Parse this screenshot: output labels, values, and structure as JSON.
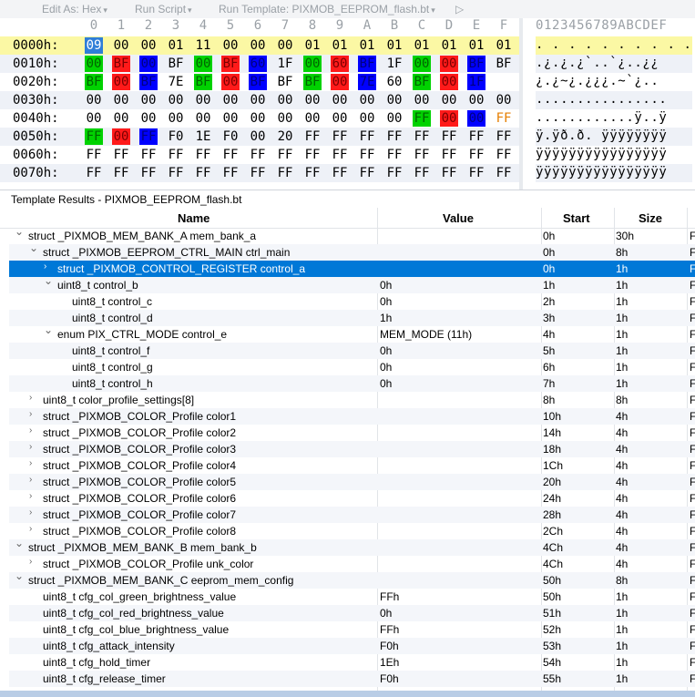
{
  "toolbar": {
    "edit_as": "Edit As: Hex",
    "run_script": "Run Script",
    "run_template": "Run Template: PIXMOB_EEPROM_flash.bt"
  },
  "hex": {
    "column_headers": [
      "0",
      "1",
      "2",
      "3",
      "4",
      "5",
      "6",
      "7",
      "8",
      "9",
      "A",
      "B",
      "C",
      "D",
      "E",
      "F"
    ],
    "ascii_header": "0123456789ABCDEF",
    "rows": [
      {
        "addr": "0000h:",
        "bytes": [
          "09",
          "00",
          "00",
          "01",
          "11",
          "00",
          "00",
          "00",
          "01",
          "01",
          "01",
          "01",
          "01",
          "01",
          "01",
          "01"
        ],
        "ascii": ".  . . . . . . . . . . . . . ."
      },
      {
        "addr": "0010h:",
        "bytes": [
          "00",
          "BF",
          "00",
          "BF",
          "00",
          "BF",
          "60",
          "1F",
          "00",
          "60",
          "BF",
          "1F",
          "00",
          "00",
          "BF",
          "BF"
        ],
        "ascii": ".¿.¿.¿`..`¿..¿¿"
      },
      {
        "addr": "0020h:",
        "bytes": [
          "BF",
          "00",
          "BF",
          "7E",
          "BF",
          "00",
          "BF",
          "BF",
          "BF",
          "00",
          "7E",
          "60",
          "BF",
          "00",
          "1F",
          ""
        ],
        "ascii": "¿.¿~¿.¿¿¿.~`¿.."
      },
      {
        "addr": "0030h:",
        "bytes": [
          "00",
          "00",
          "00",
          "00",
          "00",
          "00",
          "00",
          "00",
          "00",
          "00",
          "00",
          "00",
          "00",
          "00",
          "00",
          "00"
        ],
        "ascii": "................"
      },
      {
        "addr": "0040h:",
        "bytes": [
          "00",
          "00",
          "00",
          "00",
          "00",
          "00",
          "00",
          "00",
          "00",
          "00",
          "00",
          "00",
          "FF",
          "00",
          "00",
          "FF"
        ],
        "ascii": "............ÿ..ÿ"
      },
      {
        "addr": "0050h:",
        "bytes": [
          "FF",
          "00",
          "FF",
          "F0",
          "1E",
          "F0",
          "00",
          "20",
          "FF",
          "FF",
          "FF",
          "FF",
          "FF",
          "FF",
          "FF",
          "FF"
        ],
        "ascii": "ÿ.ÿð.ð. ÿÿÿÿÿÿÿÿ"
      },
      {
        "addr": "0060h:",
        "bytes": [
          "FF",
          "FF",
          "FF",
          "FF",
          "FF",
          "FF",
          "FF",
          "FF",
          "FF",
          "FF",
          "FF",
          "FF",
          "FF",
          "FF",
          "FF",
          "FF"
        ],
        "ascii": "ÿÿÿÿÿÿÿÿÿÿÿÿÿÿÿÿ"
      },
      {
        "addr": "0070h:",
        "bytes": [
          "FF",
          "FF",
          "FF",
          "FF",
          "FF",
          "FF",
          "FF",
          "FF",
          "FF",
          "FF",
          "FF",
          "FF",
          "FF",
          "FF",
          "FF",
          "FF"
        ],
        "ascii": "ÿÿÿÿÿÿÿÿÿÿÿÿÿÿÿÿ"
      }
    ]
  },
  "template_results": {
    "title": "Template Results - PIXMOB_EEPROM_flash.bt",
    "columns": {
      "name": "Name",
      "value": "Value",
      "start": "Start",
      "size": "Size"
    },
    "rows": [
      {
        "indent": 0,
        "twisty": "open",
        "name": "struct _PIXMOB_MEM_BANK_A mem_bank_a",
        "value": "",
        "start": "0h",
        "size": "30h",
        "color": "F"
      },
      {
        "indent": 1,
        "twisty": "open",
        "name": "struct _PIXMOB_EEPROM_CTRL_MAIN ctrl_main",
        "value": "",
        "start": "0h",
        "size": "8h",
        "color": "F"
      },
      {
        "indent": 2,
        "twisty": "closed",
        "name": "struct _PIXMOB_CONTROL_REGISTER control_a",
        "value": "",
        "start": "0h",
        "size": "1h",
        "color": "F",
        "selected": true
      },
      {
        "indent": 2,
        "twisty": "open",
        "name": "uint8_t control_b",
        "value": "0h",
        "start": "1h",
        "size": "1h",
        "color": "F"
      },
      {
        "indent": 3,
        "twisty": "",
        "name": "uint8_t control_c",
        "value": "0h",
        "start": "2h",
        "size": "1h",
        "color": "F"
      },
      {
        "indent": 3,
        "twisty": "",
        "name": "uint8_t control_d",
        "value": "1h",
        "start": "3h",
        "size": "1h",
        "color": "F"
      },
      {
        "indent": 2,
        "twisty": "open",
        "name": "enum PIX_CTRL_MODE control_e",
        "value": "MEM_MODE (11h)",
        "start": "4h",
        "size": "1h",
        "color": "F"
      },
      {
        "indent": 3,
        "twisty": "",
        "name": "uint8_t control_f",
        "value": "0h",
        "start": "5h",
        "size": "1h",
        "color": "F"
      },
      {
        "indent": 3,
        "twisty": "",
        "name": "uint8_t control_g",
        "value": "0h",
        "start": "6h",
        "size": "1h",
        "color": "F"
      },
      {
        "indent": 3,
        "twisty": "",
        "name": "uint8_t control_h",
        "value": "0h",
        "start": "7h",
        "size": "1h",
        "color": "F"
      },
      {
        "indent": 1,
        "twisty": "closed",
        "name": "uint8_t color_profile_settings[8]",
        "value": "",
        "start": "8h",
        "size": "8h",
        "color": "F"
      },
      {
        "indent": 1,
        "twisty": "closed",
        "name": "struct _PIXMOB_COLOR_Profile color1",
        "value": "",
        "start": "10h",
        "size": "4h",
        "color": "F"
      },
      {
        "indent": 1,
        "twisty": "closed",
        "name": "struct _PIXMOB_COLOR_Profile color2",
        "value": "",
        "start": "14h",
        "size": "4h",
        "color": "F"
      },
      {
        "indent": 1,
        "twisty": "closed",
        "name": "struct _PIXMOB_COLOR_Profile color3",
        "value": "",
        "start": "18h",
        "size": "4h",
        "color": "F"
      },
      {
        "indent": 1,
        "twisty": "closed",
        "name": "struct _PIXMOB_COLOR_Profile color4",
        "value": "",
        "start": "1Ch",
        "size": "4h",
        "color": "F"
      },
      {
        "indent": 1,
        "twisty": "closed",
        "name": "struct _PIXMOB_COLOR_Profile color5",
        "value": "",
        "start": "20h",
        "size": "4h",
        "color": "F"
      },
      {
        "indent": 1,
        "twisty": "closed",
        "name": "struct _PIXMOB_COLOR_Profile color6",
        "value": "",
        "start": "24h",
        "size": "4h",
        "color": "F"
      },
      {
        "indent": 1,
        "twisty": "closed",
        "name": "struct _PIXMOB_COLOR_Profile color7",
        "value": "",
        "start": "28h",
        "size": "4h",
        "color": "F"
      },
      {
        "indent": 1,
        "twisty": "closed",
        "name": "struct _PIXMOB_COLOR_Profile color8",
        "value": "",
        "start": "2Ch",
        "size": "4h",
        "color": "F"
      },
      {
        "indent": 0,
        "twisty": "open",
        "name": "struct _PIXMOB_MEM_BANK_B mem_bank_b",
        "value": "",
        "start": "4Ch",
        "size": "4h",
        "color": "F"
      },
      {
        "indent": 1,
        "twisty": "closed",
        "name": "struct _PIXMOB_COLOR_Profile unk_color",
        "value": "",
        "start": "4Ch",
        "size": "4h",
        "color": "F"
      },
      {
        "indent": 0,
        "twisty": "open",
        "name": "struct _PIXMOB_MEM_BANK_C eeprom_mem_config",
        "value": "",
        "start": "50h",
        "size": "8h",
        "color": "F"
      },
      {
        "indent": 1,
        "twisty": "",
        "name": "uint8_t cfg_col_green_brightness_value",
        "value": "FFh",
        "start": "50h",
        "size": "1h",
        "color": "F"
      },
      {
        "indent": 1,
        "twisty": "",
        "name": "uint8_t cfg_col_red_brightness_value",
        "value": "0h",
        "start": "51h",
        "size": "1h",
        "color": "F"
      },
      {
        "indent": 1,
        "twisty": "",
        "name": "uint8_t cfg_col_blue_brightness_value",
        "value": "FFh",
        "start": "52h",
        "size": "1h",
        "color": "F"
      },
      {
        "indent": 1,
        "twisty": "",
        "name": "uint8_t cfg_attack_intensity",
        "value": "F0h",
        "start": "53h",
        "size": "1h",
        "color": "F"
      },
      {
        "indent": 1,
        "twisty": "",
        "name": "uint8_t cfg_hold_timer",
        "value": "1Eh",
        "start": "54h",
        "size": "1h",
        "color": "F"
      },
      {
        "indent": 1,
        "twisty": "",
        "name": "uint8_t cfg_release_timer",
        "value": "F0h",
        "start": "55h",
        "size": "1h",
        "color": "F"
      }
    ]
  },
  "colors": {
    "selection": "#0078d7",
    "green": "#00d200",
    "red": "#ff1a1a",
    "blue": "#0000ff",
    "yellow_row": "#fbf8a4",
    "orange_text": "#e67e00"
  }
}
